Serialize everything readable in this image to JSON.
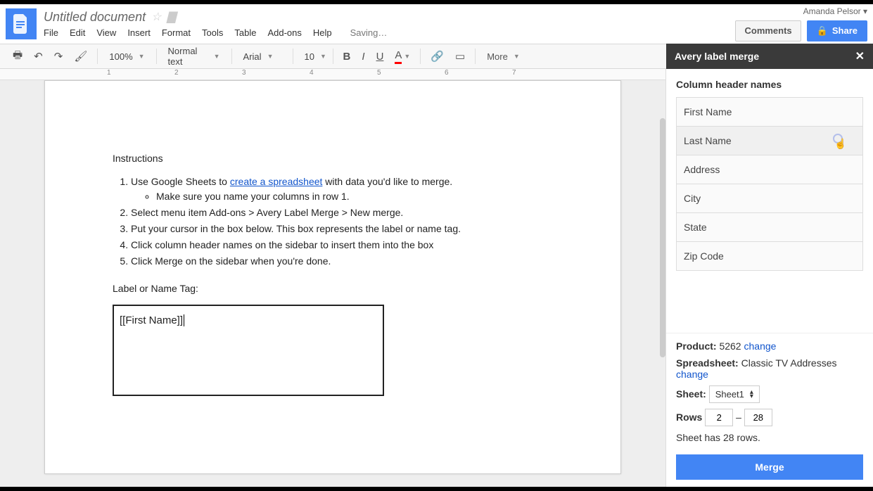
{
  "header": {
    "title": "Untitled document",
    "user": "Amanda Pelsor",
    "comments": "Comments",
    "share": "Share",
    "saving": "Saving…"
  },
  "menubar": [
    "File",
    "Edit",
    "View",
    "Insert",
    "Format",
    "Tools",
    "Table",
    "Add-ons",
    "Help"
  ],
  "toolbar": {
    "zoom": "100%",
    "style": "Normal text",
    "font": "Arial",
    "size": "10",
    "more": "More"
  },
  "ruler_ticks": [
    "1",
    "2",
    "3",
    "4",
    "5",
    "6",
    "7"
  ],
  "document": {
    "instructions_title": "Instructions",
    "step1_a": "Use Google Sheets to ",
    "step1_link": "create a spreadsheet",
    "step1_b": " with data you'd like to merge.",
    "step1_sub": "Make sure you name your columns in row 1.",
    "step2": "Select menu item Add-ons > Avery Label Merge > New merge.",
    "step3": "Put your cursor in the box below. This box represents the label or name tag.",
    "step4": "Click column header names on the sidebar to insert them into the box",
    "step5": "Click Merge on the sidebar when you're done.",
    "label_heading": "Label or Name Tag:",
    "tag_content": "[[First Name]]"
  },
  "sidebar": {
    "title": "Avery label merge",
    "section": "Column header names",
    "columns": [
      "First Name",
      "Last Name",
      "Address",
      "City",
      "State",
      "Zip Code"
    ],
    "product_label": "Product:",
    "product_value": "5262",
    "spreadsheet_label": "Spreadsheet:",
    "spreadsheet_value": "Classic TV Addresses",
    "sheet_label": "Sheet:",
    "sheet_value": "Sheet1",
    "rows_label": "Rows",
    "rows_from": "2",
    "rows_to": "28",
    "rows_info": "Sheet has 28 rows.",
    "change": "change",
    "merge": "Merge"
  }
}
